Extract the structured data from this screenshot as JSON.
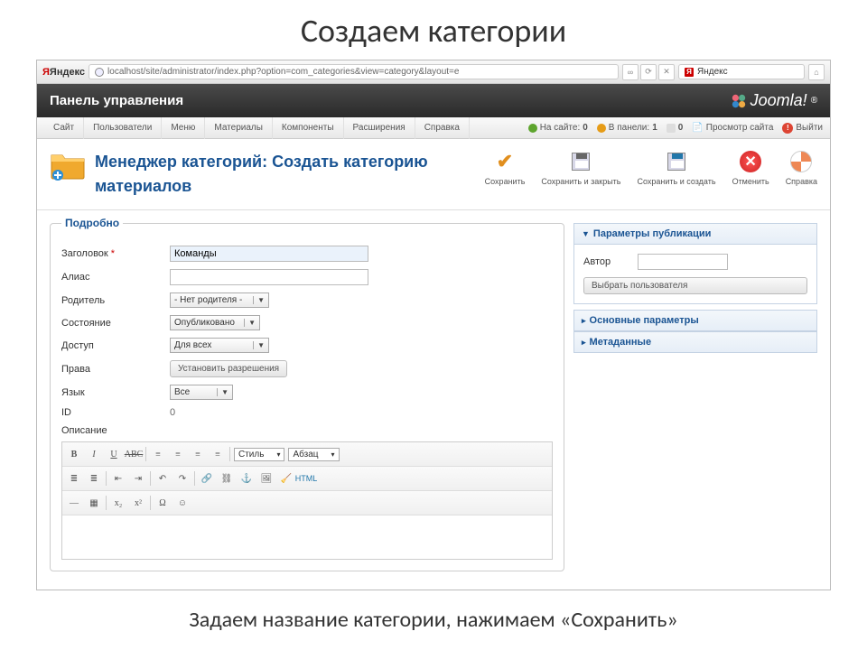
{
  "slide": {
    "title": "Создаем категории",
    "caption": "Задаем название категории, нажимаем «Сохранить»"
  },
  "url_bar": {
    "search_engine": "Яндекс",
    "address": "localhost/site/administrator/index.php?option=com_categories&view=category&layout=e",
    "search_placeholder": "Яндекс"
  },
  "header": {
    "control_panel": "Панель управления",
    "brand": "Joomla!"
  },
  "top_menu": {
    "items": [
      "Сайт",
      "Пользователи",
      "Меню",
      "Материалы",
      "Компоненты",
      "Расширения",
      "Справка"
    ],
    "status": {
      "on_site_label": "На сайте:",
      "on_site_value": "0",
      "in_panel_label": "В панели:",
      "in_panel_value": "1",
      "messages": "0",
      "preview": "Просмотр сайта",
      "logout": "Выйти"
    }
  },
  "page": {
    "title": "Менеджер категорий: Создать категорию материалов"
  },
  "toolbar": {
    "save": "Сохранить",
    "save_close": "Сохранить и закрыть",
    "save_new": "Сохранить и создать",
    "cancel": "Отменить",
    "help": "Справка"
  },
  "form": {
    "legend": "Подробно",
    "labels": {
      "title": "Заголовок",
      "alias": "Алиас",
      "parent": "Родитель",
      "state": "Состояние",
      "access": "Доступ",
      "permissions": "Права",
      "language": "Язык",
      "id": "ID",
      "description": "Описание"
    },
    "values": {
      "title": "Команды",
      "alias": "",
      "parent": "- Нет родителя -",
      "state": "Опубликовано",
      "access": "Для всех",
      "permissions_btn": "Установить разрешения",
      "language": "Все",
      "id": "0"
    }
  },
  "editor": {
    "style": "Стиль",
    "para": "Абзац",
    "html_btn": "HTML"
  },
  "right": {
    "panels": {
      "publishing": "Параметры публикации",
      "basic": "Основные параметры",
      "meta": "Метаданные"
    },
    "author_label": "Автор",
    "pick_user": "Выбрать пользователя"
  }
}
